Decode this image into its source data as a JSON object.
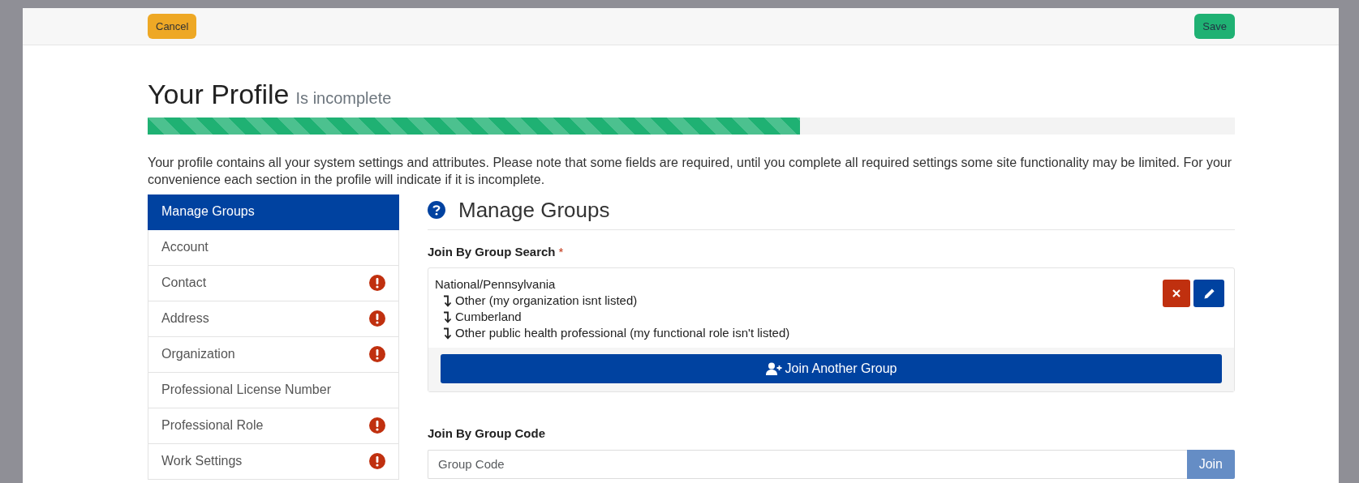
{
  "header": {
    "buttons": [
      {
        "label": "Cancel",
        "kind": "cancel"
      },
      {
        "label": "Save",
        "kind": "save"
      }
    ]
  },
  "title": {
    "main": "Your Profile",
    "status": "Is incomplete"
  },
  "progress": {
    "level": 0.6
  },
  "intro": "Your profile contains all your system settings and attributes. Please note that some fields are required, until you complete all required settings some site functionality may be limited. For your convenience each section in the profile will indicate if it is incomplete.",
  "sidebar": {
    "items": [
      {
        "label": "Manage Groups",
        "selected": true,
        "incomplete": false
      },
      {
        "label": "Account",
        "selected": false,
        "incomplete": false
      },
      {
        "label": "Contact",
        "selected": false,
        "incomplete": true
      },
      {
        "label": "Address",
        "selected": false,
        "incomplete": true
      },
      {
        "label": "Organization",
        "selected": false,
        "incomplete": true
      },
      {
        "label": "Professional License Number",
        "selected": false,
        "incomplete": false
      },
      {
        "label": "Professional Role",
        "selected": false,
        "incomplete": true
      },
      {
        "label": "Work Settings",
        "selected": false,
        "incomplete": true
      }
    ]
  },
  "section": {
    "title": "Manage Groups",
    "group_search": {
      "label": "Join By Group Search",
      "required_mark": "*",
      "group": {
        "name": "National/Pennsylvania",
        "subgroups": [
          "Other (my organization isnt listed)",
          "Cumberland",
          "Other public health professional (my functional role isn't listed)"
        ]
      },
      "join_another": "Join Another Group"
    },
    "group_code": {
      "label": "Join By Group Code",
      "placeholder": "Group Code",
      "button": {
        "label": "Join",
        "disabled": true
      }
    }
  }
}
